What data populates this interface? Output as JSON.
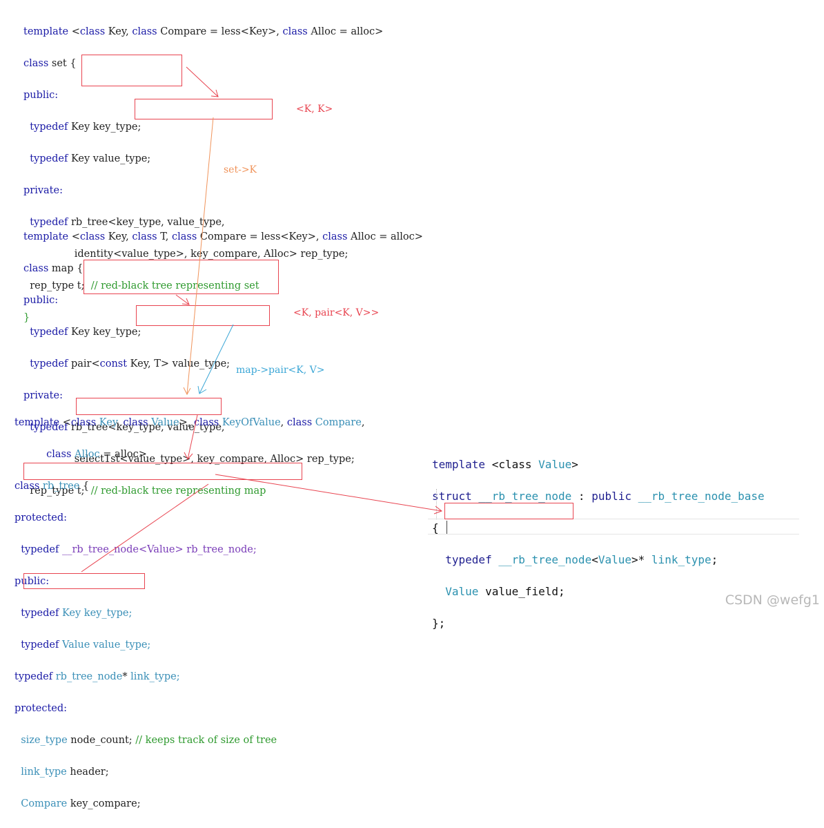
{
  "set_block": {
    "l1": {
      "template": "template",
      "lt": "<",
      "class1": "class",
      "key": " Key, ",
      "class2": "class",
      "cmp": " Compare = less<Key>, ",
      "class3": "class",
      "alloc": " Alloc = alloc>"
    },
    "l2": {
      "class": "class",
      "rest": " set {"
    },
    "l3": {
      "public": "public:"
    },
    "l4": {
      "typedef": "typedef",
      "rest": " Key key_type;"
    },
    "l5": {
      "typedef": "typedef",
      "rest": " Key value_type;"
    },
    "l6": {
      "private": "private:"
    },
    "l7": {
      "typedef": "typedef",
      "rest": " rb_tree<key_type, value_type,"
    },
    "l8": {
      "rest": "identity<value_type>, key_compare, Alloc> rep_type;"
    },
    "l9": {
      "rest": "rep_type t;  ",
      "comment": "// red-black tree representing set"
    },
    "l10": {
      "brace": "}"
    }
  },
  "map_block": {
    "l1": {
      "template": "template",
      "lt": " <",
      "class1": "class",
      "key": " Key, ",
      "class2": "class",
      "t": " T, ",
      "class3": "class",
      "cmp": " Compare = less<Key>, ",
      "class4": "class",
      "alloc": " Alloc = alloc>"
    },
    "l2": {
      "class": "class",
      "rest": " map {"
    },
    "l3": {
      "public": "public:"
    },
    "l4": {
      "typedef": "typedef",
      "rest": " Key key_type;"
    },
    "l5": {
      "typedef": "typedef",
      "pair": " pair<",
      "const": "const",
      "rest": " Key, T> value_type;"
    },
    "l6": {
      "private": "private:"
    },
    "l7": {
      "typedef": "typedef",
      "rest": " rb_tree<key_type, value_type,"
    },
    "l8": {
      "rest": "select1st<value_type>, key_compare, Alloc> rep_type;"
    },
    "l9": {
      "rest": "rep_type t;  ",
      "comment": "// red-black tree representing map"
    }
  },
  "rbtree_block": {
    "l1": {
      "template": "template",
      "lt": " <",
      "class1": "class",
      "key": " Key",
      "comma1": ", ",
      "class2": "class",
      "value": " Value",
      "comma2": ">, ",
      "class3": "class",
      "kov": " KeyOfValue",
      "comma3": ", ",
      "class4": "class",
      "cmp": " Compare",
      "comma4": ","
    },
    "l2": {
      "class": "class",
      "alloc": " Alloc",
      "rest": " = alloc>"
    },
    "l3": {
      "class": "class",
      "name": " rb_tree",
      "rest": " {"
    },
    "l4": {
      "protected": "protected:"
    },
    "l5": {
      "typedef": "typedef",
      "rest": " __rb_tree_node<Value> rb_tree_node;"
    },
    "l6": {
      "public": "public:"
    },
    "l7": {
      "typedef": "typedef",
      "type": " Key",
      "rest": " key_type;"
    },
    "l8": {
      "typedef": "typedef",
      "type": " Value",
      "rest": " value_type;"
    },
    "l9": {
      "typedef": "typedef",
      "type": " rb_tree_node",
      "star": "*",
      "rest": " link_type;"
    },
    "l10": {
      "protected": "protected:"
    },
    "l11": {
      "type": "size_type",
      "rest": " node_count; ",
      "comment": "// keeps track of size of tree"
    },
    "l12": {
      "type": "link_type",
      "rest": " header;"
    },
    "l13": {
      "type": "Compare",
      "rest": " key_compare;"
    }
  },
  "node_block": {
    "l1": {
      "template": "template",
      "rest": " <class ",
      "value": "Value",
      "gt": ">"
    },
    "l2": {
      "struct": "struct",
      "name": " __rb_tree_node",
      "colon": " : ",
      "public": "public",
      "base": " __rb_tree_node_base"
    },
    "l3": {
      "brace": "{"
    },
    "l4": {
      "typedef": "typedef",
      "name": " __rb_tree_node",
      "lt": "<",
      "value": "Value",
      "rest": ">* ",
      "link": "link_type",
      ";": ";"
    },
    "l5": {
      "value": "Value",
      "rest": " value_field;"
    },
    "l6": {
      "brace": "};"
    }
  },
  "annotations": {
    "set_kk": "<K, K>",
    "set_arrow": "set->K",
    "map_kpair": "<K, pair<K, V>>",
    "map_arrow": "map->pair<K, V>"
  },
  "watermark": "CSDN @wefg1",
  "colors": {
    "box": "#e8434f",
    "orange": "#f0935a",
    "blue": "#3aa6d6",
    "keyword": "#1a1aa6",
    "comment": "#2f9a2f",
    "type": "#3a8fb7"
  }
}
